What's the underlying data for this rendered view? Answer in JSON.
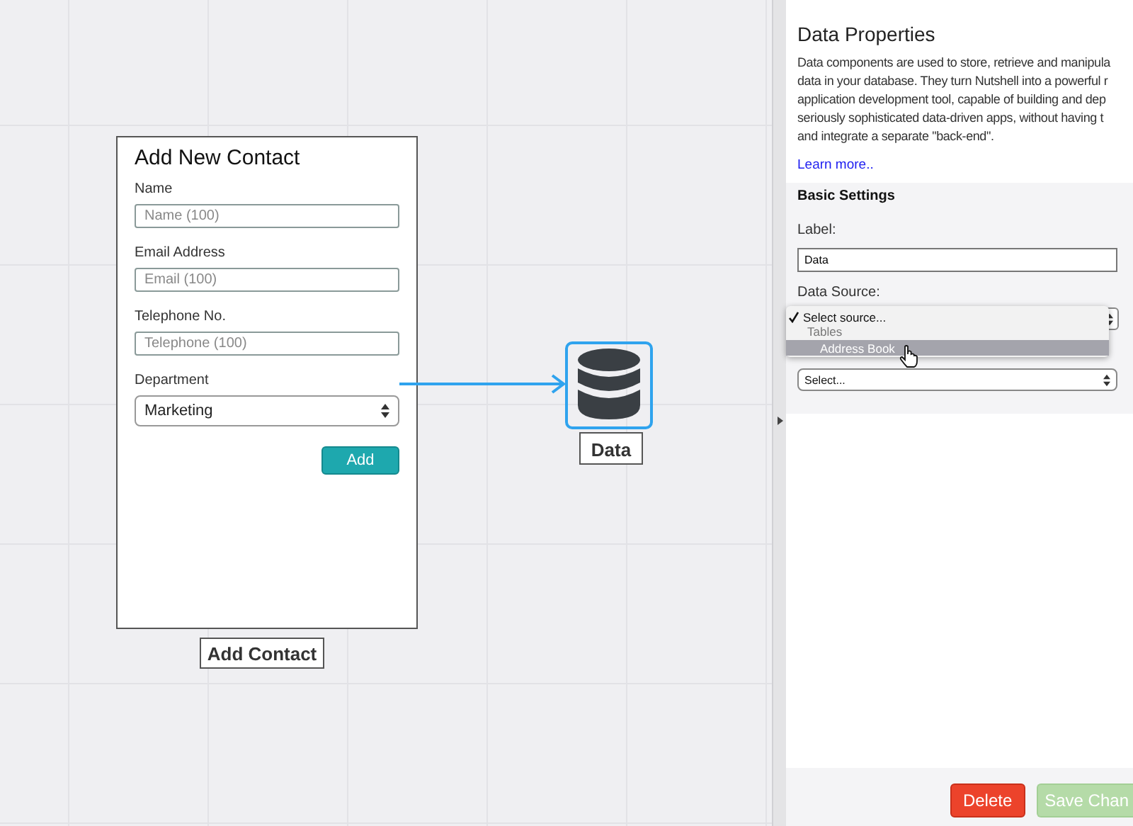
{
  "canvas": {
    "form_card": {
      "title": "Add New Contact",
      "fields": [
        {
          "kind": "text",
          "label": "Name",
          "placeholder": "Name (100)"
        },
        {
          "kind": "text",
          "label": "Email Address",
          "placeholder": "Email (100)"
        },
        {
          "kind": "text",
          "label": "Telephone No.",
          "placeholder": "Telephone (100)"
        },
        {
          "kind": "select",
          "label": "Department",
          "value": "Marketing"
        }
      ],
      "submit": "Add",
      "caption": "Add Contact"
    },
    "data_node": {
      "caption": "Data",
      "selected": true
    }
  },
  "panel": {
    "title": "Data Properties",
    "description": "Data components are used to store, retrieve and manipula\ndata in your database. They turn Nutshell into a powerful r\napplication development tool, capable of building and dep\nseriously sophisticated data-driven apps, without having t\nand integrate a separate \"back-end\".",
    "link": "Learn more..",
    "section": "Basic Settings",
    "label_field": {
      "label": "Label:",
      "value": "Data"
    },
    "source_field": {
      "label": "Data Source:",
      "menu": [
        {
          "kind": "option",
          "text": "Select source...",
          "checked": true,
          "highlighted": false
        },
        {
          "kind": "group",
          "text": "Tables"
        },
        {
          "kind": "option",
          "text": "Address Book",
          "checked": false,
          "highlighted": true
        }
      ]
    },
    "second_select": {
      "value": "Select..."
    },
    "buttons": [
      {
        "kind": "danger",
        "label": "Delete",
        "disabled": false
      },
      {
        "kind": "primary",
        "label": "Save Chan",
        "disabled": true
      }
    ]
  }
}
